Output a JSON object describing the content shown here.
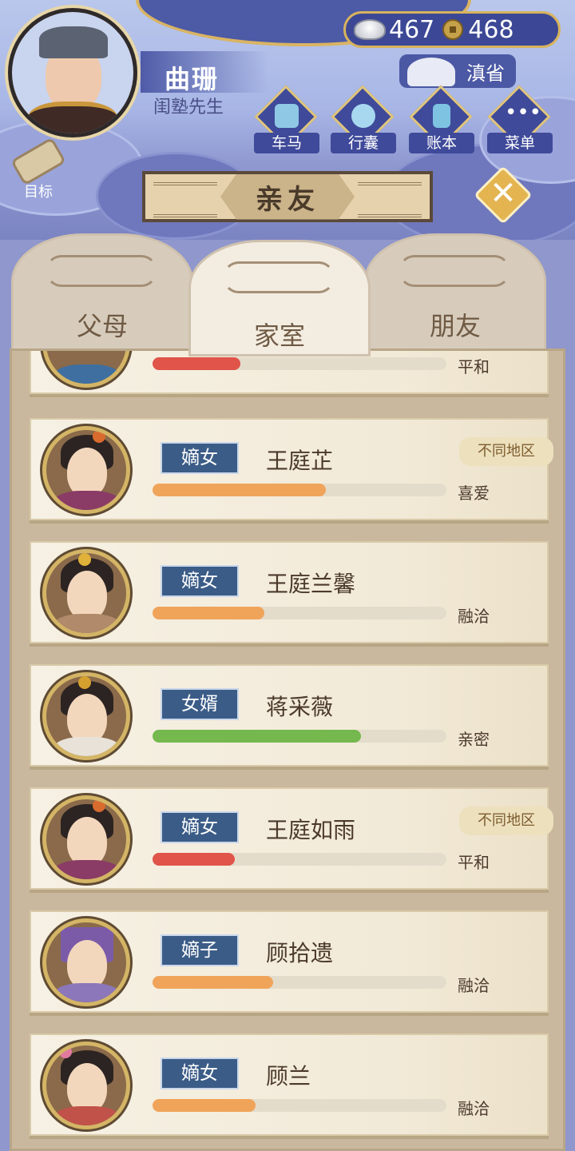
{
  "player": {
    "name": "曲珊",
    "title": "闺塾先生"
  },
  "currency": {
    "silver": "467",
    "gold": "468"
  },
  "province": "滇省",
  "quick_buttons": [
    {
      "label": "车马",
      "icon": "carriage-icon"
    },
    {
      "label": "行囊",
      "icon": "bag-icon"
    },
    {
      "label": "账本",
      "icon": "ledger-icon"
    },
    {
      "label": "菜单",
      "icon": "menu-dots-icon"
    }
  ],
  "goal_label": "目标",
  "banner_title": "亲友",
  "tabs": [
    {
      "label": "父母",
      "active": false
    },
    {
      "label": "家室",
      "active": true
    },
    {
      "label": "朋友",
      "active": false
    }
  ],
  "partial_card": {
    "relation": "平和",
    "affinity": 0.3,
    "bar_color": "#e0544a"
  },
  "members": [
    {
      "role": "嫡女",
      "name": "王庭芷",
      "region": "不同地区",
      "relation": "喜爱",
      "affinity": 0.59,
      "bar_color": "#f0a45a",
      "robe": "#8a3b66"
    },
    {
      "role": "嫡女",
      "name": "王庭兰馨",
      "region": "",
      "relation": "融洽",
      "affinity": 0.38,
      "bar_color": "#f0a45a",
      "robe": "#b08a6a"
    },
    {
      "role": "女婿",
      "name": "蒋采薇",
      "region": "",
      "relation": "亲密",
      "affinity": 0.71,
      "bar_color": "#74b84e",
      "robe": "#e8e2d8"
    },
    {
      "role": "嫡女",
      "name": "王庭如雨",
      "region": "不同地区",
      "relation": "平和",
      "affinity": 0.28,
      "bar_color": "#e0544a",
      "robe": "#8a3b66"
    },
    {
      "role": "嫡子",
      "name": "顾拾遗",
      "region": "",
      "relation": "融洽",
      "affinity": 0.41,
      "bar_color": "#f0a45a",
      "robe": "#8b77b9"
    },
    {
      "role": "嫡女",
      "name": "顾兰",
      "region": "",
      "relation": "融洽",
      "affinity": 0.35,
      "bar_color": "#f0a45a",
      "robe": "#c0524a"
    }
  ]
}
